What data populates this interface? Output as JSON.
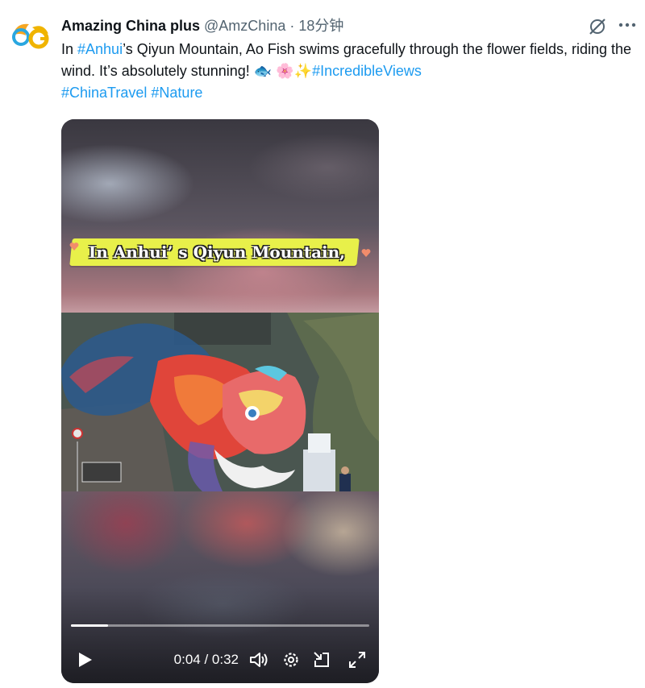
{
  "tweet": {
    "author_name": "Amazing China plus",
    "handle": "@AmzChina",
    "separator": "·",
    "time": "18分钟",
    "text_1": "In ",
    "hashtag_anhui": "#Anhui",
    "text_2": "’s Qiyun Mountain, Ao Fish swims gracefully through the flower fields, riding the wind. It’s absolutely stunning! ",
    "emoji_fish": "🐟",
    "emoji_blossom": "🌸",
    "emoji_sparkles": "✨",
    "hashtag_views": "#IncredibleViews",
    "hashtag_travel": "#ChinaTravel",
    "hashtag_nature": "#Nature"
  },
  "icons": {
    "grok": "grok-icon",
    "more": "more-options-icon",
    "play": "play-icon",
    "volume": "volume-icon",
    "settings": "settings-icon",
    "pip": "picture-in-picture-icon",
    "fullscreen": "fullscreen-icon"
  },
  "video": {
    "caption": "In Anhui’ s Qiyun Mountain,",
    "current_time": "0:04",
    "time_separator": " / ",
    "duration": "0:32",
    "progress": 0.125
  },
  "colors": {
    "accent": "#1d9bf0",
    "text": "#0f1419",
    "muted": "#536471",
    "caption_band": "#e8f04a"
  }
}
